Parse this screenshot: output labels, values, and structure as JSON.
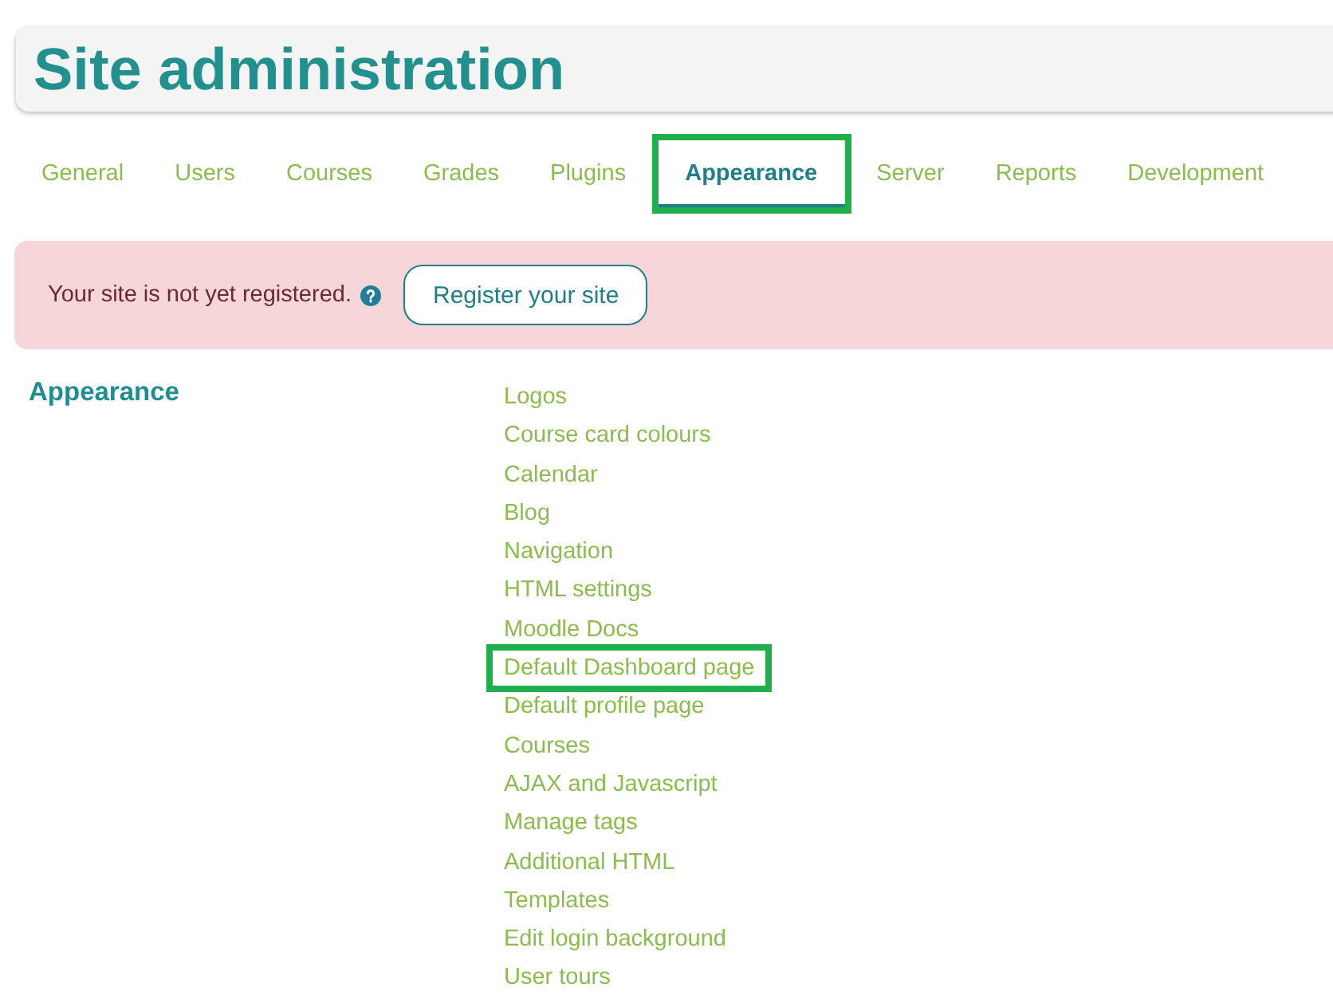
{
  "header": {
    "title": "Site administration"
  },
  "tabs": [
    {
      "label": "General",
      "selected": false,
      "highlighted": false
    },
    {
      "label": "Users",
      "selected": false,
      "highlighted": false
    },
    {
      "label": "Courses",
      "selected": false,
      "highlighted": false
    },
    {
      "label": "Grades",
      "selected": false,
      "highlighted": false
    },
    {
      "label": "Plugins",
      "selected": false,
      "highlighted": false
    },
    {
      "label": "Appearance",
      "selected": true,
      "highlighted": true
    },
    {
      "label": "Server",
      "selected": false,
      "highlighted": false
    },
    {
      "label": "Reports",
      "selected": false,
      "highlighted": false
    },
    {
      "label": "Development",
      "selected": false,
      "highlighted": false
    }
  ],
  "alert": {
    "message": "Your site is not yet registered.",
    "button": "Register your site"
  },
  "section": {
    "heading": "Appearance",
    "links": [
      {
        "label": "Logos",
        "highlighted": false
      },
      {
        "label": "Course card colours",
        "highlighted": false
      },
      {
        "label": "Calendar",
        "highlighted": false
      },
      {
        "label": "Blog",
        "highlighted": false
      },
      {
        "label": "Navigation",
        "highlighted": false
      },
      {
        "label": "HTML settings",
        "highlighted": false
      },
      {
        "label": "Moodle Docs",
        "highlighted": false
      },
      {
        "label": "Default Dashboard page",
        "highlighted": true
      },
      {
        "label": "Default profile page",
        "highlighted": false
      },
      {
        "label": "Courses",
        "highlighted": false
      },
      {
        "label": "AJAX and Javascript",
        "highlighted": false
      },
      {
        "label": "Manage tags",
        "highlighted": false
      },
      {
        "label": "Additional HTML",
        "highlighted": false
      },
      {
        "label": "Templates",
        "highlighted": false
      },
      {
        "label": "Edit login background",
        "highlighted": false
      },
      {
        "label": "User tours",
        "highlighted": false
      }
    ]
  }
}
